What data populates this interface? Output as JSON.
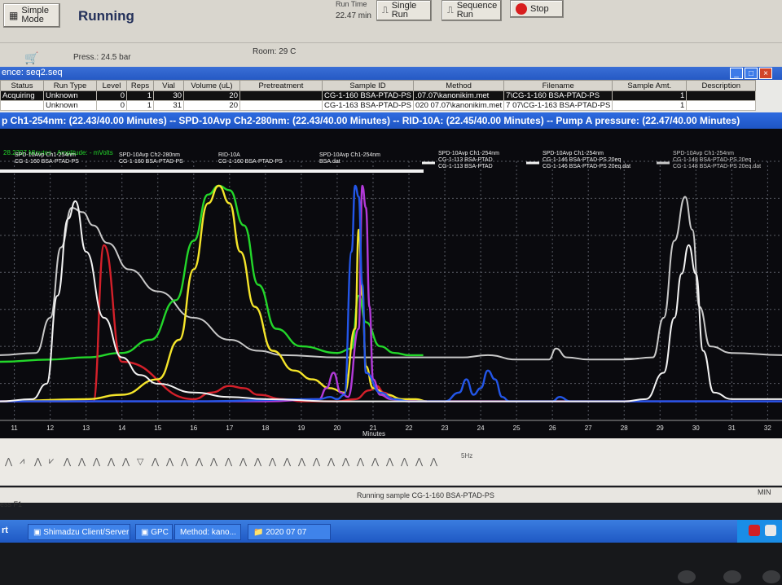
{
  "toolbar": {
    "simple_mode": "Simple Mode",
    "status": "Running",
    "run_time_label": "Run Time",
    "run_time_value": "22.47 min",
    "single_run": "Single Run",
    "sequence_run": "Sequence Run",
    "stop": "Stop"
  },
  "status_bar": {
    "press": "Press.: 24.5 bar",
    "room": "Room: 29 C"
  },
  "sequence": {
    "title": "ence: seq2.seq",
    "headers": [
      "Status",
      "Run Type",
      "Level",
      "Reps",
      "Vial",
      "Volume (uL)",
      "Pretreatment",
      "Sample ID",
      "Method",
      "Filename",
      "Sample Amt.",
      "Description"
    ],
    "rows": [
      [
        "Acquiring",
        "Unknown",
        "0",
        "1",
        "30",
        "20",
        "",
        "CG-1-160 BSA-PTAD-PS",
        ".07.07\\kanonikim.met",
        "7\\CG-1-160 BSA-PTAD-PS",
        "1",
        ""
      ],
      [
        "",
        "Unknown",
        "0",
        "1",
        "31",
        "20",
        "",
        "CG-1-163 BSA-PTAD-PS",
        "020 07.07\\kanonikim.met",
        "7 07\\CG-1-163 BSA-PTAD-PS",
        "1",
        ""
      ]
    ]
  },
  "chrom": {
    "title": "p Ch1-254nm: (22.43/40.00 Minutes) -- SPD-10Avp Ch2-280nm: (22.43/40.00 Minutes) -- RID-10A: (22.45/40.00 Minutes) -- Pump A pressure: (22.47/40.00 Minutes)",
    "subtitle": "28.2207 Minutes - Amplitude: - mVolts",
    "xlabel": "Minutes",
    "xticks": [
      "11",
      "12",
      "13",
      "14",
      "15",
      "16",
      "17",
      "18",
      "19",
      "20",
      "21",
      "22",
      "23",
      "24",
      "25",
      "26",
      "27",
      "28",
      "29",
      "30",
      "31",
      "32"
    ],
    "legend": [
      {
        "l1": "SPD-10Avp Ch1-254nm",
        "l2": "CG-1-160 BSA-PTAD-PS"
      },
      {
        "l1": "SPD-10Avp Ch2-280nm",
        "l2": "CG-1-160 BSA-PTAD-PS"
      },
      {
        "l1": "RID-10A",
        "l2": "CG-1-160 BSA-PTAD-PS"
      },
      {
        "l1": "SPD-10Avp Ch1-254nm",
        "l2": "BSA.dat"
      },
      {
        "l1": "SPD-10Avp Ch1-254nm",
        "l2": "CG-1-113 BSA-PTAD",
        "l3": "CG-1-113 BSA-PTAD"
      },
      {
        "l1": "SPD-10Avp Ch1-254nm",
        "l2": "CG-1-146 BSA-PTAD-PS 20eq",
        "l3": "CG-1-146 BSA-PTAD-PS 20eq.dat"
      },
      {
        "l1": "SPD-10Avp Ch1-254nm",
        "l2": "CG-1-148 BSA-PTAD-PS 20eq",
        "l3": "CG-1-148 BSA-PTAD-PS 20eq.dat"
      }
    ],
    "colors": {
      "white": "#f2f2f2",
      "grey": "#c8c8c8",
      "green": "#23d62a",
      "yellow": "#f5e52a",
      "red": "#d4202a",
      "blue": "#2356e8",
      "purple": "#b23ad8",
      "gridline": "#5a5d66",
      "bg": "#0a0a0e"
    }
  },
  "chart_data": {
    "type": "line",
    "xlabel": "Minutes",
    "xlim": [
      10.6,
      32.4
    ],
    "ylim": [
      0,
      100
    ],
    "series": [
      {
        "color": "white",
        "x": [
          10.6,
          11.5,
          11.9,
          12.2,
          12.5,
          12.7,
          13.0,
          13.5,
          14.0,
          14.5,
          15.0,
          16.0,
          17.0,
          18.0,
          20.0,
          22.0,
          24.0,
          26.0,
          28.0,
          28.6,
          29.1,
          29.4,
          29.6,
          29.8,
          30.0,
          30.2,
          30.5,
          31.0,
          32.4
        ],
        "y": [
          2,
          3,
          10,
          50,
          85,
          93,
          70,
          40,
          22,
          14,
          10,
          6,
          4,
          3,
          2,
          2,
          2,
          2,
          2,
          3,
          15,
          40,
          60,
          73,
          60,
          25,
          6,
          3,
          3
        ]
      },
      {
        "color": "grey",
        "x": [
          10.6,
          11.6,
          12.0,
          12.3,
          12.6,
          12.9,
          13.2,
          13.6,
          14.2,
          15.0,
          16.0,
          17.0,
          17.8,
          18.5,
          20.0,
          22.0,
          23.5,
          24.2,
          25.0,
          25.9,
          26.1,
          26.4,
          27.0,
          28.0,
          28.8,
          29.1,
          29.4,
          29.7,
          29.9,
          30.1,
          30.4,
          31.0,
          32.4
        ],
        "y": [
          23,
          24,
          40,
          72,
          90,
          88,
          82,
          74,
          62,
          52,
          40,
          30,
          25,
          23,
          22,
          22,
          22,
          23,
          21,
          21,
          26,
          22,
          21,
          21,
          22,
          40,
          75,
          95,
          80,
          45,
          27,
          24,
          23
        ]
      },
      {
        "color": "green",
        "x": [
          10.6,
          12.0,
          13.0,
          14.0,
          14.8,
          15.5,
          16.0,
          16.4,
          16.7,
          17.0,
          17.4,
          17.8,
          18.3,
          19.0,
          20.0,
          20.4,
          20.6,
          20.8,
          21.2,
          21.6,
          22.0,
          22.4
        ],
        "y": [
          20,
          21,
          22,
          24,
          30,
          48,
          75,
          96,
          100,
          98,
          82,
          55,
          35,
          27,
          24,
          26,
          50,
          38,
          27,
          24,
          23,
          23
        ]
      },
      {
        "color": "yellow",
        "x": [
          10.6,
          13.0,
          14.0,
          15.0,
          15.6,
          16.0,
          16.4,
          16.7,
          17.0,
          17.3,
          17.7,
          18.2,
          18.8,
          19.3,
          19.8,
          20.2,
          20.5,
          20.6,
          20.7,
          20.8,
          21.0,
          21.4,
          21.8,
          22.2,
          22.5
        ],
        "y": [
          2,
          3,
          5,
          12,
          30,
          62,
          92,
          100,
          92,
          70,
          45,
          25,
          16,
          12,
          8,
          6,
          35,
          80,
          50,
          18,
          8,
          5,
          3,
          3,
          2
        ]
      },
      {
        "color": "red",
        "x": [
          10.6,
          13.2,
          13.5,
          14.0,
          16.0,
          16.5,
          17.0,
          17.4,
          17.8,
          18.5,
          19.0,
          19.5,
          20.0,
          20.5,
          20.9,
          21.1,
          21.3,
          21.6,
          22.5
        ],
        "y": [
          2,
          2,
          73,
          20,
          3,
          6,
          9,
          8,
          5,
          3,
          2,
          2,
          2,
          3,
          7,
          9,
          6,
          3,
          2
        ]
      },
      {
        "color": "blue",
        "x": [
          10.6,
          16.0,
          19.5,
          19.8,
          20.0,
          20.2,
          20.4,
          20.5,
          20.6,
          20.7,
          20.8,
          21.2,
          21.6,
          22.0,
          22.5,
          23.0,
          23.4,
          23.6,
          23.8,
          24.0,
          24.2,
          24.4,
          24.6,
          24.8,
          25.5,
          26.0,
          26.2,
          26.5,
          28.0,
          32.4
        ],
        "y": [
          2,
          2,
          3,
          4,
          3,
          5,
          70,
          100,
          95,
          55,
          15,
          6,
          3,
          2,
          2,
          2,
          6,
          12,
          5,
          8,
          16,
          12,
          4,
          2,
          2,
          2,
          4,
          2,
          2,
          2
        ]
      },
      {
        "color": "purple",
        "x": [
          10.6,
          18.0,
          19.5,
          19.7,
          19.9,
          20.1,
          20.3,
          20.6,
          20.7,
          20.8,
          20.9,
          21.0,
          21.2,
          21.5,
          22.0,
          24.0,
          26.0,
          28.0,
          32.4
        ],
        "y": [
          2,
          2,
          3,
          8,
          15,
          6,
          4,
          35,
          100,
          90,
          45,
          12,
          5,
          3,
          2,
          2,
          2,
          2,
          2
        ]
      }
    ]
  },
  "peak_toolbar": {
    "last_label": "5Hz"
  },
  "run_status": {
    "message": "Running sample CG-1-160 BSA-PTAD-PS",
    "left": "ess F1",
    "right": "MIN"
  },
  "taskbar": {
    "items": [
      "Shimadzu Client/Server",
      "GPC",
      "Method: kano...",
      "2020 07 07"
    ],
    "start": "rt"
  }
}
